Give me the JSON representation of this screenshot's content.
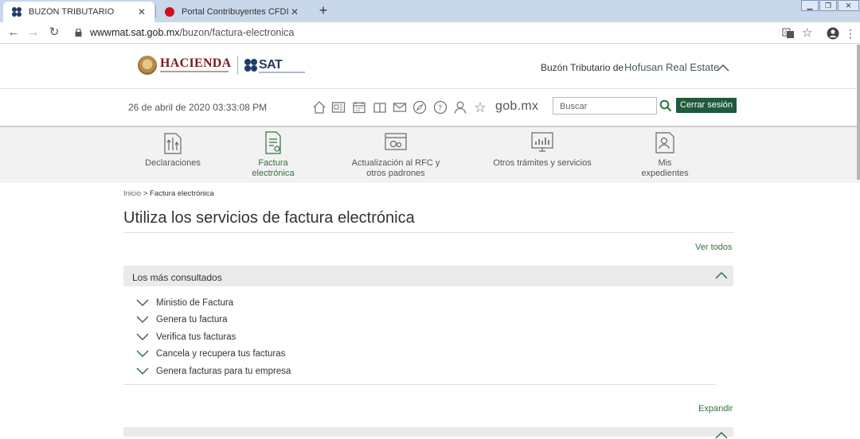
{
  "browser": {
    "tabs": [
      {
        "title": "BUZÓN TRIBUTARIO",
        "active": true
      },
      {
        "title": "Portal Contribuyentes CFDI | S",
        "active": false
      }
    ],
    "url_host": "wwwmat.sat.gob.mx",
    "url_path": "/buzon/factura-electronica"
  },
  "header": {
    "logo_hacienda": "HACIENDA",
    "logo_sat": "SAT",
    "buzon_label": "Buzón Tributario de",
    "company": "Hofusan Real Estate"
  },
  "utility": {
    "datetime": "26 de abril de 2020 03:33:08 PM",
    "gobmx": "gob.mx",
    "search_placeholder": "Buscar",
    "logout_label": "Cerrar sesión"
  },
  "services": [
    {
      "line1": "Declaraciones",
      "line2": ""
    },
    {
      "line1": "Factura",
      "line2": "electrónica"
    },
    {
      "line1": "Actualización al RFC y",
      "line2": "otros padrones"
    },
    {
      "line1": "Otros trámites y servicios",
      "line2": ""
    },
    {
      "line1": "Mis",
      "line2": "expedientes"
    }
  ],
  "breadcrumb": {
    "home": "Inicio",
    "sep": ">",
    "current": "Factura electrónica"
  },
  "page_title": "Utiliza los servicios de factura electrónica",
  "ver_todos": "Ver todos",
  "panel1": {
    "title": "Los más consultados",
    "items": [
      "Ministio de Factura",
      "Genera tu factura",
      "Verifica tus facturas",
      "Cancela y recupera tus facturas",
      "Genera facturas para tu empresa"
    ]
  },
  "expandir": "Expandir",
  "colors": {
    "accent_green": "#33723f",
    "button_green": "#1e5b3c",
    "hacienda_red": "#7b1a1a"
  }
}
